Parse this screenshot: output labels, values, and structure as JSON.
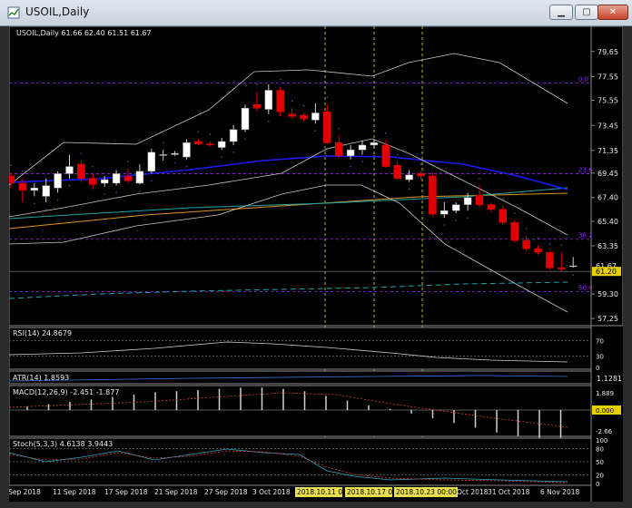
{
  "window": {
    "title": "USOIL,Daily",
    "minimize_icon": "minimize-icon",
    "maximize_icon": "maximize-icon",
    "close_icon": "close-icon"
  },
  "main": {
    "header": "USOIL,Daily  61.66 62.40 61.51 61.67",
    "price_labels": [
      "79.65",
      "77.55",
      "75.55",
      "73.45",
      "71.35",
      "69.45",
      "67.40",
      "65.40",
      "63.35",
      "61.67",
      "61.20",
      "59.30",
      "57.25"
    ],
    "fib_labels": [
      "0.0",
      "23.6",
      "38.2",
      "50.0"
    ],
    "current_price": "61.67",
    "bid_price": "61.20"
  },
  "rsi": {
    "label": "RSI(14) 24.8679",
    "levels": [
      "70",
      "30",
      "0"
    ]
  },
  "atr": {
    "label": "ATR(14) 1.8593",
    "scale": "1.1281"
  },
  "macd": {
    "label": "MACD(12,26,9) -2.451 -1.877",
    "scale_top": "1.889",
    "zero": "0.000",
    "scale_bottom": "-2.66"
  },
  "stoch": {
    "label": "Stoch(5,3,3) 4.6138 3.9443",
    "levels": [
      "100",
      "80",
      "50",
      "20",
      "0"
    ]
  },
  "xaxis": {
    "labels": [
      "5 Sep 2018",
      "11 Sep 2018",
      "17 Sep 2018",
      "21 Sep 2018",
      "27 Sep 2018",
      "3 Oct 2018",
      "Oct 2018",
      "31 Oct 2018",
      "6 Nov 2018"
    ],
    "highlighted": [
      "2018.10.11 00",
      "2018.10.17 00",
      "2018.10.23 00:00"
    ]
  },
  "colors": {
    "bull": "#ffffff",
    "bear": "#e00000",
    "ma_blue": "#1c1cff",
    "ma_orange": "#e0941a",
    "ma_teal": "#1aa5a5",
    "bands": "#c8c8c8",
    "fib": "#a020f0",
    "vline": "#e8e050"
  },
  "chart_data": {
    "type": "candlestick",
    "title": "USOIL,Daily",
    "ohlc_last": {
      "open": 61.66,
      "high": 62.4,
      "low": 61.51,
      "close": 61.67
    },
    "candles": [
      {
        "o": 69.2,
        "h": 69.5,
        "l": 68.2,
        "c": 68.6
      },
      {
        "o": 68.6,
        "h": 69.0,
        "l": 67.0,
        "c": 68.0
      },
      {
        "o": 68.0,
        "h": 68.6,
        "l": 67.5,
        "c": 68.2
      },
      {
        "o": 67.5,
        "h": 69.0,
        "l": 67.0,
        "c": 68.4
      },
      {
        "o": 68.2,
        "h": 69.6,
        "l": 67.8,
        "c": 69.4
      },
      {
        "o": 69.4,
        "h": 71.0,
        "l": 69.0,
        "c": 70.0
      },
      {
        "o": 70.2,
        "h": 70.5,
        "l": 68.7,
        "c": 69.0
      },
      {
        "o": 69.0,
        "h": 69.4,
        "l": 68.1,
        "c": 68.5
      },
      {
        "o": 68.6,
        "h": 69.2,
        "l": 68.3,
        "c": 68.9
      },
      {
        "o": 68.6,
        "h": 69.7,
        "l": 68.4,
        "c": 69.4
      },
      {
        "o": 69.2,
        "h": 69.8,
        "l": 68.6,
        "c": 68.8
      },
      {
        "o": 68.6,
        "h": 70.2,
        "l": 68.5,
        "c": 69.6
      },
      {
        "o": 69.6,
        "h": 71.5,
        "l": 69.4,
        "c": 71.2
      },
      {
        "o": 71.0,
        "h": 71.4,
        "l": 70.5,
        "c": 71.0
      },
      {
        "o": 71.0,
        "h": 71.3,
        "l": 70.9,
        "c": 71.1
      },
      {
        "o": 70.8,
        "h": 72.3,
        "l": 70.6,
        "c": 72.0
      },
      {
        "o": 72.1,
        "h": 72.3,
        "l": 71.8,
        "c": 71.9
      },
      {
        "o": 71.9,
        "h": 72.1,
        "l": 71.7,
        "c": 71.8
      },
      {
        "o": 71.6,
        "h": 72.4,
        "l": 71.4,
        "c": 72.1
      },
      {
        "o": 72.1,
        "h": 73.5,
        "l": 71.8,
        "c": 73.1
      },
      {
        "o": 73.1,
        "h": 75.2,
        "l": 72.9,
        "c": 74.9
      },
      {
        "o": 75.2,
        "h": 76.3,
        "l": 74.6,
        "c": 74.9
      },
      {
        "o": 74.8,
        "h": 76.9,
        "l": 74.4,
        "c": 76.4
      },
      {
        "o": 76.4,
        "h": 76.7,
        "l": 74.2,
        "c": 74.6
      },
      {
        "o": 74.4,
        "h": 74.9,
        "l": 74.0,
        "c": 74.2
      },
      {
        "o": 74.3,
        "h": 74.5,
        "l": 73.8,
        "c": 74.0
      },
      {
        "o": 73.9,
        "h": 75.3,
        "l": 73.6,
        "c": 74.5
      },
      {
        "o": 74.6,
        "h": 75.2,
        "l": 71.9,
        "c": 72.0
      },
      {
        "o": 72.0,
        "h": 72.6,
        "l": 70.7,
        "c": 70.9
      },
      {
        "o": 70.9,
        "h": 71.8,
        "l": 70.6,
        "c": 71.4
      },
      {
        "o": 71.4,
        "h": 72.2,
        "l": 71.0,
        "c": 71.8
      },
      {
        "o": 71.8,
        "h": 72.3,
        "l": 71.5,
        "c": 72.0
      },
      {
        "o": 71.8,
        "h": 72.2,
        "l": 69.9,
        "c": 70.0
      },
      {
        "o": 70.1,
        "h": 70.4,
        "l": 68.9,
        "c": 69.0
      },
      {
        "o": 68.9,
        "h": 69.7,
        "l": 68.7,
        "c": 69.3
      },
      {
        "o": 69.4,
        "h": 69.6,
        "l": 68.9,
        "c": 69.2
      },
      {
        "o": 69.2,
        "h": 69.5,
        "l": 65.8,
        "c": 66.0
      },
      {
        "o": 66.0,
        "h": 67.0,
        "l": 65.7,
        "c": 66.3
      },
      {
        "o": 66.3,
        "h": 67.0,
        "l": 66.1,
        "c": 66.8
      },
      {
        "o": 66.8,
        "h": 67.8,
        "l": 66.3,
        "c": 67.4
      },
      {
        "o": 67.6,
        "h": 68.4,
        "l": 66.6,
        "c": 66.8
      },
      {
        "o": 66.8,
        "h": 67.0,
        "l": 66.2,
        "c": 66.4
      },
      {
        "o": 66.4,
        "h": 66.7,
        "l": 65.1,
        "c": 65.3
      },
      {
        "o": 65.3,
        "h": 65.5,
        "l": 63.6,
        "c": 63.8
      },
      {
        "o": 63.8,
        "h": 64.2,
        "l": 62.9,
        "c": 63.1
      },
      {
        "o": 63.1,
        "h": 63.4,
        "l": 62.6,
        "c": 62.8
      },
      {
        "o": 62.8,
        "h": 62.9,
        "l": 61.3,
        "c": 61.5
      },
      {
        "o": 61.5,
        "h": 62.8,
        "l": 61.2,
        "c": 61.4
      },
      {
        "o": 61.66,
        "h": 62.4,
        "l": 61.51,
        "c": 61.67
      }
    ]
  }
}
